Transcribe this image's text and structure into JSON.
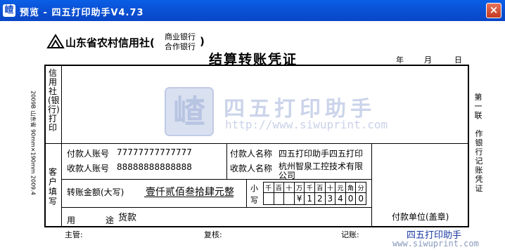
{
  "window": {
    "title": "预览 - 四五打印助手V4.73",
    "close_label": "×",
    "icon_glyph": "嵖"
  },
  "form": {
    "bank_name": "山东省农村信用社(",
    "bank_sub_1": "商业银行",
    "bank_sub_2": "合作银行",
    "bank_close": ")",
    "title": "结算转账凭证",
    "date_year": "年",
    "date_month": "月",
    "date_day": "日",
    "left_side_1": "信用社(银行)打印",
    "left_side_2": "客户填写",
    "left_margin_note": "2009B 山东省 90mm×190mm 2009.4",
    "right_side_1": "第一联",
    "right_side_2": "作银行记账凭证",
    "payer_account_label": "付款人账号",
    "payer_account_value": "77777777777777",
    "receiver_account_label": "收款人账号",
    "receiver_account_value": "88888888888888",
    "payer_name_label": "付款人名称",
    "payer_name_value": "四五打印助手四五打印",
    "receiver_name_label": "收款人名称",
    "receiver_name_value_1": "杭州智泉工控技术有限",
    "receiver_name_value_2": "公司",
    "amount_label": "转账金额(大写)",
    "amount_words": "壹仟贰佰叁拾肆元整",
    "small_label_1": "小",
    "small_label_2": "写",
    "amount_headers": [
      "千",
      "百",
      "十",
      "万",
      "千",
      "百",
      "十",
      "元",
      "角",
      "分"
    ],
    "amount_digits": [
      "",
      "",
      "",
      "¥",
      "1",
      "2",
      "3",
      "4",
      "0",
      "0"
    ],
    "purpose_label_1": "用",
    "purpose_label_2": "途",
    "purpose_value": "货款",
    "payer_seal": "付款单位(盖章)",
    "footer_supervisor": "主管:",
    "footer_review": "复核:",
    "footer_bookkeeper": "记账:"
  },
  "watermark": {
    "name": "四五打印助手",
    "url": "http://www.siwuprint.com"
  },
  "corner": {
    "name": "四五打印助手",
    "url": "www.siwuprint.com"
  },
  "colors": {
    "titlebar": "#0a53d8",
    "watermark": "#c9d3ea",
    "corner_text": "#1a3aa0"
  }
}
